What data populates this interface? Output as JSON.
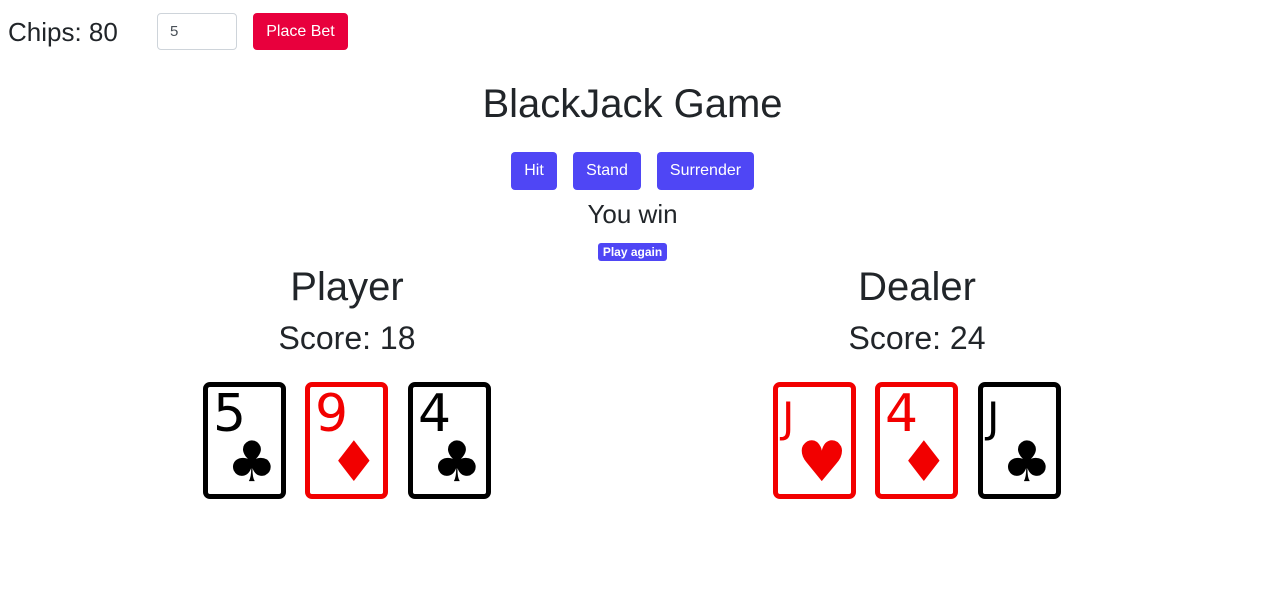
{
  "header": {
    "chips_text": "Chips: 80",
    "bet_value": "5",
    "place_bet_label": "Place Bet"
  },
  "title": "BlackJack Game",
  "actions": {
    "hit_label": "Hit",
    "stand_label": "Stand",
    "surrender_label": "Surrender"
  },
  "result": {
    "message": "You win",
    "play_again_label": "Play again"
  },
  "player": {
    "title": "Player",
    "score_text": "Score: 18",
    "cards": [
      {
        "rank": "5",
        "suit": "♣",
        "color": "black"
      },
      {
        "rank": "9",
        "suit": "♦",
        "color": "red"
      },
      {
        "rank": "4",
        "suit": "♣",
        "color": "black"
      }
    ]
  },
  "dealer": {
    "title": "Dealer",
    "score_text": "Score: 24",
    "cards": [
      {
        "rank": "J",
        "suit": "♥",
        "color": "red"
      },
      {
        "rank": "4",
        "suit": "♦",
        "color": "red"
      },
      {
        "rank": "J",
        "suit": "♣",
        "color": "black"
      }
    ]
  },
  "colors": {
    "bet_button": "#e8003d",
    "action_button": "#4f46f5",
    "red_card": "#f20000",
    "black_card": "#000000"
  }
}
